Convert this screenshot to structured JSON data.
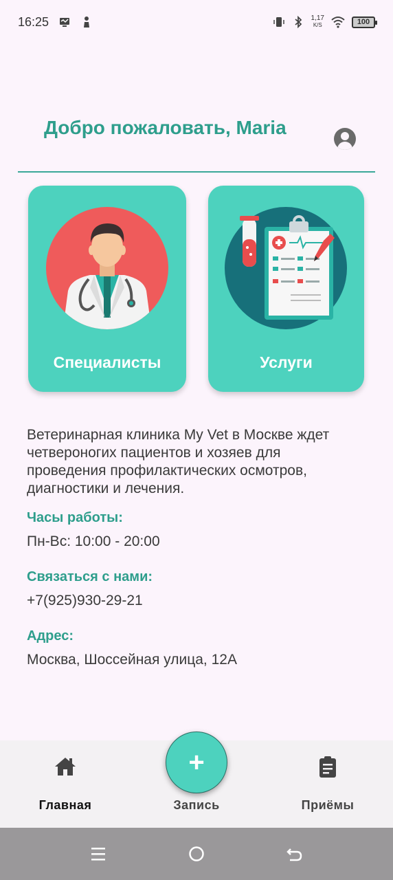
{
  "status_bar": {
    "time": "16:25",
    "net_speed_value": "1,17",
    "net_speed_unit": "K/S",
    "battery": "100"
  },
  "header": {
    "welcome": "Добро пожаловать, Maria"
  },
  "cards": {
    "specialists_label": "Специалисты",
    "services_label": "Услуги"
  },
  "info": {
    "description": "Ветеринарная клиника My Vet в Москве ждет четвероногих пациентов и хозяев для проведения профилактических осмотров, диагностики и лечения.",
    "hours_title": "Часы работы:",
    "hours_value": "Пн-Вс: 10:00 - 20:00",
    "contact_title": "Связаться с нами:",
    "contact_value": "+7(925)930-29-21",
    "address_title": "Адрес:",
    "address_value": "Москва, Шоссейная улица, 12А"
  },
  "bottom_nav": {
    "home_label": "Главная",
    "record_label": "Запись",
    "appointments_label": "Приёмы",
    "fab_symbol": "+"
  },
  "colors": {
    "accent": "#2e9e8c",
    "card": "#4dd2be",
    "background": "#fcf4fc"
  }
}
